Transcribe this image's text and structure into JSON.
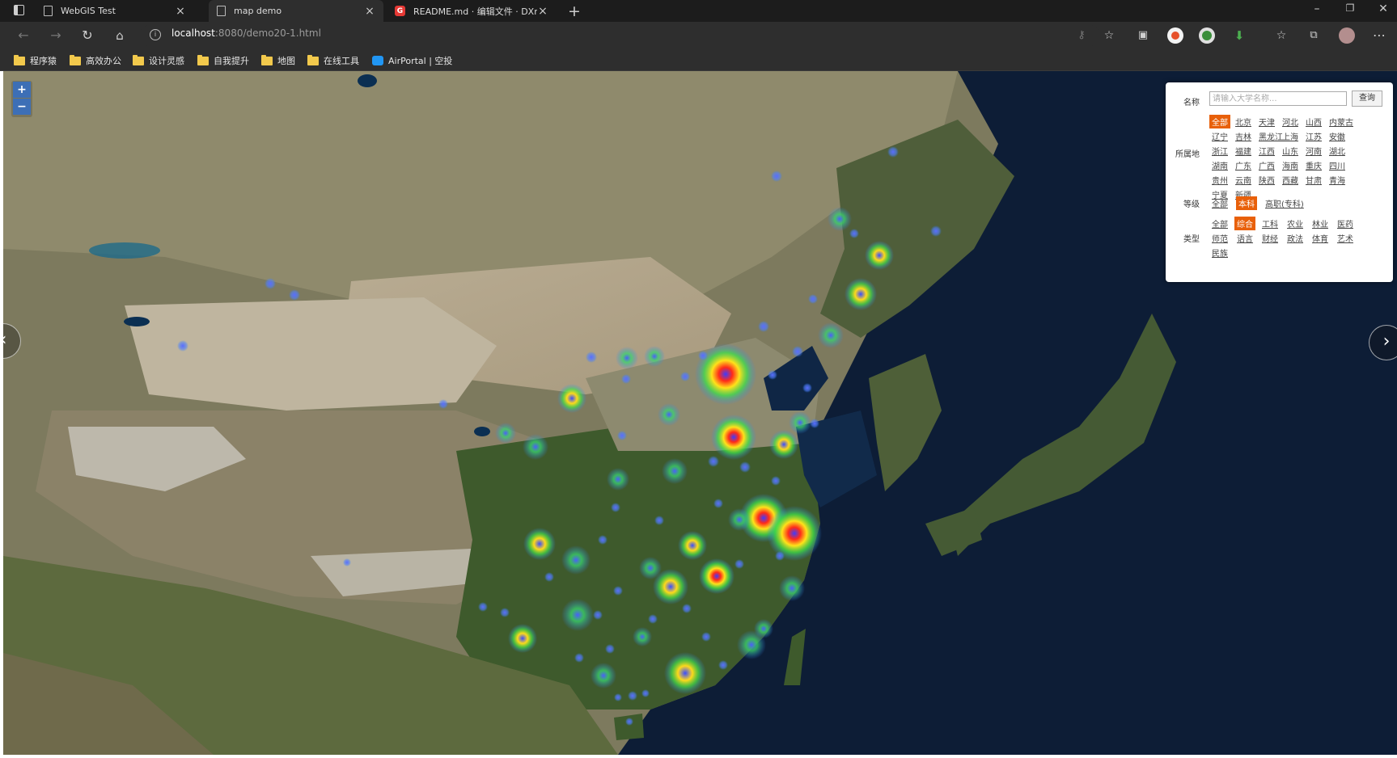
{
  "browser": {
    "tabs": [
      {
        "title": "WebGIS Test",
        "active": false
      },
      {
        "title": "map demo",
        "active": true
      },
      {
        "title": "README.md · 编辑文件 · DXnim",
        "active": false
      }
    ],
    "url_host": "localhost",
    "url_path": ":8080/demo20-1.html",
    "bookmarks": [
      "程序猿",
      "高效办公",
      "设计灵感",
      "自我提升",
      "地图",
      "在线工具",
      "AirPortal | 空投"
    ]
  },
  "map": {
    "zoom_in": "+",
    "zoom_out": "−",
    "prev_arrow": "‹",
    "next_arrow": "›"
  },
  "panel": {
    "name_label": "名称",
    "search_placeholder": "请输入大学名称...",
    "query_button": "查询",
    "location_label": "所属地",
    "locations": [
      "全部",
      "北京",
      "天津",
      "河北",
      "山西",
      "内蒙古",
      "辽宁",
      "吉林",
      "黑龙江",
      "上海",
      "江苏",
      "安徽",
      "浙江",
      "福建",
      "江西",
      "山东",
      "河南",
      "湖北",
      "湖南",
      "广东",
      "广西",
      "海南",
      "重庆",
      "四川",
      "贵州",
      "云南",
      "陕西",
      "西藏",
      "甘肃",
      "青海",
      "宁夏",
      "新疆"
    ],
    "level_label": "等级",
    "levels": [
      "全部",
      "本科",
      "高职(专科)"
    ],
    "type_label": "类型",
    "types": [
      "全部",
      "综合",
      "工科",
      "农业",
      "林业",
      "医药",
      "师范",
      "语言",
      "财经",
      "政法",
      "体育",
      "艺术",
      "民族"
    ],
    "selected_location": "全部",
    "selected_level": "本科",
    "selected_type": "综合"
  },
  "colors": {
    "accent": "#e8600a",
    "zoom_button": "#3d6fb6",
    "tab_bar": "#1c1c1c",
    "toolbar": "#2e2e2e"
  }
}
